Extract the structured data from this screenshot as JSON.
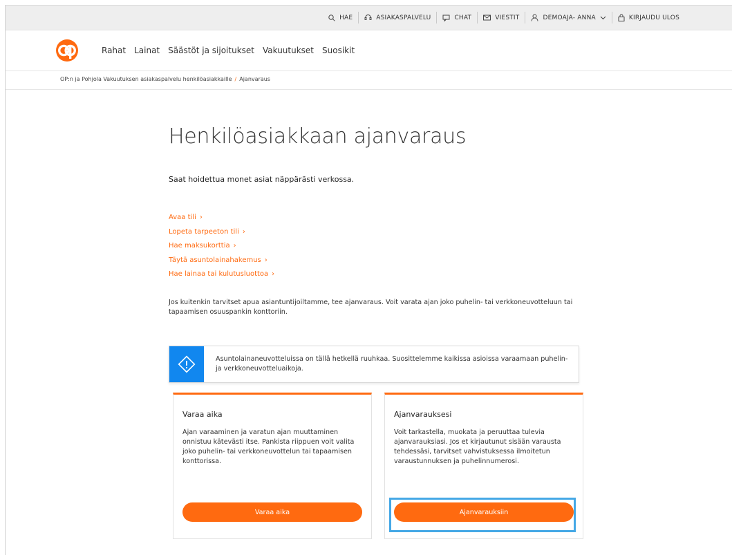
{
  "utility_bar": {
    "search": "HAE",
    "customer_service": "ASIAKASPALVELU",
    "chat": "CHAT",
    "messages": "VIESTIT",
    "user": "DEMOAJA- ANNA",
    "logout": "KIRJAUDU ULOS"
  },
  "nav": {
    "items": [
      "Rahat",
      "Lainat",
      "Säästöt ja sijoitukset",
      "Vakuutukset",
      "Suosikit"
    ]
  },
  "breadcrumb": {
    "parent": "OP:n ja Pohjola Vakuutuksen asiakaspalvelu henkilöasiakkaille",
    "separator": "/",
    "current": "Ajanvaraus"
  },
  "page": {
    "title": "Henkilöasiakkaan ajanvaraus",
    "lead": "Saat hoidettua monet asiat näppärästi verkossa.",
    "links": [
      "Avaa tili",
      "Lopeta tarpeeton tili",
      "Hae maksukorttia",
      "Täytä asuntolainahakemus",
      "Hae lainaa tai kulutusluottoa"
    ],
    "link_arrow": "›",
    "paragraph": "Jos kuitenkin tarvitset apua asiantuntijoiltamme, tee ajanvaraus. Voit varata ajan joko puhelin- tai verkkoneuvotteluun tai tapaamisen osuuspankin konttoriin.",
    "notice": "Asuntolainaneuvotteluissa on tällä hetkellä ruuhkaa. Suosittelemme kaikissa asioissa varaamaan puhelin- ja verkkoneuvotteluaikoja."
  },
  "cards": {
    "book": {
      "title": "Varaa aika",
      "text": "Ajan varaaminen ja varatun ajan muuttaminen onnistuu kätevästi itse. Pankista riippuen voit valita joko puhelin- tai verkkoneuvottelun tai tapaamisen konttorissa.",
      "button": "Varaa aika"
    },
    "my_bookings": {
      "title": "Ajanvarauksesi",
      "text": "Voit tarkastella, muokata ja peruuttaa tulevia ajanvarauksiasi. Jos et kirjautunut sisään varausta tehdessäsi, tarvitset vahvistuksessa ilmoitetun varaustunnuksen ja puhelinnumerosi.",
      "button": "Ajanvarauksiin"
    }
  },
  "colors": {
    "brand_orange": "#ff6a10",
    "info_blue": "#1187ef",
    "highlight_blue": "#45a8e6"
  },
  "icons": [
    "search-icon",
    "headset-icon",
    "chat-icon",
    "mail-icon",
    "user-icon",
    "chevron-down-icon",
    "lock-icon",
    "op-logo",
    "warning-icon"
  ]
}
